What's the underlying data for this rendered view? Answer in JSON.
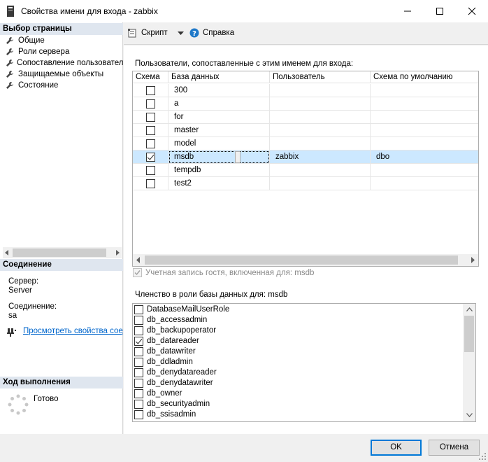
{
  "window": {
    "title": "Свойства имени для входа - zabbix"
  },
  "sidebar": {
    "section_pages": "Выбор страницы",
    "items": [
      {
        "label": "Общие"
      },
      {
        "label": "Роли сервера"
      },
      {
        "label": "Сопоставление пользователей"
      },
      {
        "label": "Защищаемые объекты"
      },
      {
        "label": "Состояние"
      }
    ],
    "section_connection": "Соединение",
    "server_label": "Сервер:",
    "server_value": "Server",
    "connection_label": "Соединение:",
    "connection_value": "sa",
    "view_props_link": "Просмотреть свойства соединения",
    "section_progress": "Ход выполнения",
    "progress_status": "Готово"
  },
  "toolbar": {
    "script_label": "Скрипт",
    "help_label": "Справка"
  },
  "mapping": {
    "caption": "Пользователи, сопоставленные с этим именем для входа:",
    "columns": [
      "Схема",
      "База данных",
      "Пользователь",
      "Схема по умолчанию"
    ],
    "rows": [
      {
        "checked": false,
        "database": "300",
        "user": "",
        "schema": ""
      },
      {
        "checked": false,
        "database": "a",
        "user": "",
        "schema": ""
      },
      {
        "checked": false,
        "database": "for",
        "user": "",
        "schema": ""
      },
      {
        "checked": false,
        "database": "master",
        "user": "",
        "schema": ""
      },
      {
        "checked": false,
        "database": "model",
        "user": "",
        "schema": ""
      },
      {
        "checked": true,
        "database": "msdb",
        "user": "zabbix",
        "schema": "dbo",
        "selected": true
      },
      {
        "checked": false,
        "database": "tempdb",
        "user": "",
        "schema": ""
      },
      {
        "checked": false,
        "database": "test2",
        "user": "",
        "schema": ""
      }
    ],
    "guest_label": "Учетная запись гостя, включенная для: msdb",
    "guest_checked": true
  },
  "roles": {
    "caption": "Членство в роли базы данных для: msdb",
    "items": [
      {
        "label": "DatabaseMailUserRole",
        "checked": false
      },
      {
        "label": "db_accessadmin",
        "checked": false
      },
      {
        "label": "db_backupoperator",
        "checked": false
      },
      {
        "label": "db_datareader",
        "checked": true
      },
      {
        "label": "db_datawriter",
        "checked": false
      },
      {
        "label": "db_ddladmin",
        "checked": false
      },
      {
        "label": "db_denydatareader",
        "checked": false
      },
      {
        "label": "db_denydatawriter",
        "checked": false
      },
      {
        "label": "db_owner",
        "checked": false
      },
      {
        "label": "db_securityadmin",
        "checked": false
      },
      {
        "label": "db_ssisadmin",
        "checked": false
      }
    ]
  },
  "footer": {
    "ok_label": "OK",
    "cancel_label": "Отмена"
  },
  "colors": {
    "section_header": "#dfe6ef",
    "selection": "#cce8ff",
    "link": "#0066cc",
    "primary_border": "#0078d7"
  }
}
